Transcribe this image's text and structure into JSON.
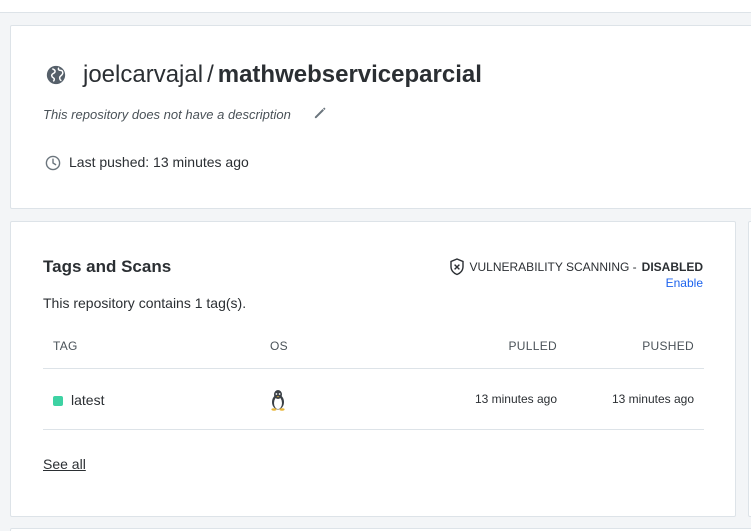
{
  "repo": {
    "namespace": "joelcarvajal",
    "separator": "/",
    "name": "mathwebserviceparcial",
    "description": "This repository does not have a description",
    "last_pushed": "Last pushed: 13 minutes ago"
  },
  "tags_section": {
    "title": "Tags and Scans",
    "vuln_label": "VULNERABILITY SCANNING -",
    "vuln_status": "DISABLED",
    "enable_label": "Enable",
    "contains_text": "This repository contains 1 tag(s).",
    "columns": {
      "tag": "TAG",
      "os": "OS",
      "pulled": "PULLED",
      "pushed": "PUSHED"
    },
    "rows": [
      {
        "tag": "latest",
        "os_icon": "linux-tux-icon",
        "pulled": "13 minutes ago",
        "pushed": "13 minutes ago",
        "status_color": "#3ed2a3"
      }
    ],
    "see_all_label": "See all"
  },
  "colors": {
    "link": "#1d63ed",
    "tag_status": "#3ed2a3",
    "text": "#2b2f33"
  }
}
